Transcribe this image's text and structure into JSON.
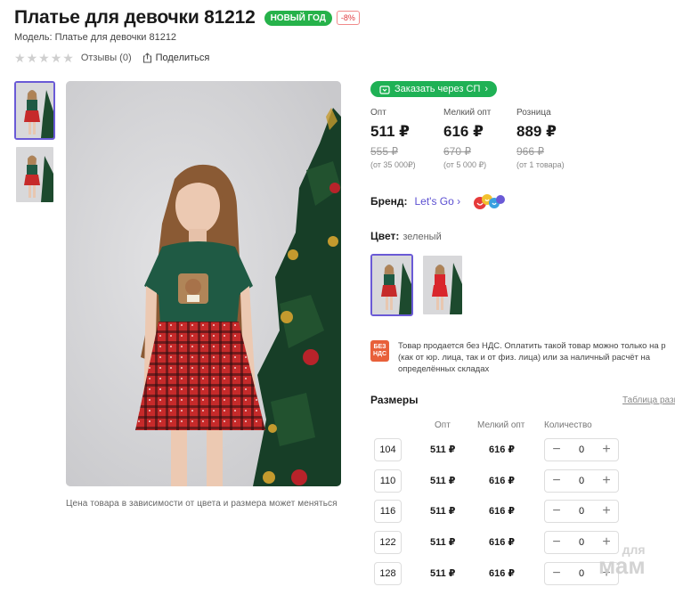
{
  "product": {
    "title": "Платье для девочки 81212",
    "badge_new_year": "НОВЫЙ ГОД",
    "badge_discount": "-8%",
    "model": "Модель: Платье для девочки 81212",
    "reviews": "Отзывы (0)",
    "share": "Поделиться",
    "rating_stars": 0
  },
  "gallery": {
    "caption": "Цена товара в зависимости от цвета и размера может меняться"
  },
  "sp_button": "Заказать через СП",
  "prices": [
    {
      "label": "Опт",
      "price": "511 ₽",
      "old": "555 ₽",
      "note": "(от 35 000₽)"
    },
    {
      "label": "Мелкий опт",
      "price": "616 ₽",
      "old": "670 ₽",
      "note": "(от 5 000 ₽)"
    },
    {
      "label": "Розница",
      "price": "889 ₽",
      "old": "966 ₽",
      "note": "(от 1 товара)"
    }
  ],
  "brand": {
    "label": "Бренд:",
    "name": "Let's Go"
  },
  "color": {
    "label": "Цвет:",
    "value": "зеленый"
  },
  "vat": {
    "badge_line1": "БЕЗ",
    "badge_line2": "НДС",
    "text": "Товар продается без НДС. Оплатить такой товар можно только на р\n(как от юр. лица, так и от физ. лица) или за наличный расчёт на\nопределённых складах"
  },
  "sizes": {
    "title": "Размеры",
    "table_link": "Таблица разм",
    "headers": {
      "opt": "Опт",
      "small_opt": "Мелкий опт",
      "quantity": "Количество"
    },
    "rows": [
      {
        "size": "104",
        "opt": "511 ₽",
        "small_opt": "616 ₽",
        "qty": "0"
      },
      {
        "size": "110",
        "opt": "511 ₽",
        "small_opt": "616 ₽",
        "qty": "0"
      },
      {
        "size": "116",
        "opt": "511 ₽",
        "small_opt": "616 ₽",
        "qty": "0"
      },
      {
        "size": "122",
        "opt": "511 ₽",
        "small_opt": "616 ₽",
        "qty": "0"
      },
      {
        "size": "128",
        "opt": "511 ₽",
        "small_opt": "616 ₽",
        "qty": "0"
      }
    ]
  },
  "watermark": {
    "line1": "для",
    "line2": "мам"
  },
  "colors": {
    "accent_green": "#26b24a",
    "brand_purple": "#6a5ad6",
    "dress_top": "#1f5a44",
    "dress_skirt": "#c62a2a"
  }
}
